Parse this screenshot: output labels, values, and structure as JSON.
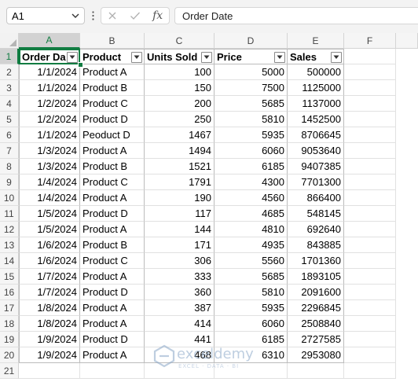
{
  "formula_bar": {
    "name_box": "A1",
    "fx_symbol": "fx",
    "content": "Order Date"
  },
  "columns": [
    "A",
    "B",
    "C",
    "D",
    "E",
    "F"
  ],
  "selected_column": "A",
  "selected_row": "1",
  "table": {
    "headers": [
      "Order Da",
      "Product",
      "Units Sold",
      "Price",
      "Sales"
    ],
    "rows": [
      [
        "1/1/2024",
        "Product A",
        "100",
        "5000",
        "500000"
      ],
      [
        "1/1/2024",
        "Product B",
        "150",
        "7500",
        "1125000"
      ],
      [
        "1/2/2024",
        "Product C",
        "200",
        "5685",
        "1137000"
      ],
      [
        "1/2/2024",
        "Product D",
        "250",
        "5810",
        "1452500"
      ],
      [
        "1/1/2024",
        "Peoduct D",
        "1467",
        "5935",
        "8706645"
      ],
      [
        "1/3/2024",
        "Product A",
        "1494",
        "6060",
        "9053640"
      ],
      [
        "1/3/2024",
        "Product B",
        "1521",
        "6185",
        "9407385"
      ],
      [
        "1/4/2024",
        "Product C",
        "1791",
        "4300",
        "7701300"
      ],
      [
        "1/4/2024",
        "Product A",
        "190",
        "4560",
        "866400"
      ],
      [
        "1/5/2024",
        "Product D",
        "117",
        "4685",
        "548145"
      ],
      [
        "1/5/2024",
        "Product A",
        "144",
        "4810",
        "692640"
      ],
      [
        "1/6/2024",
        "Product B",
        "171",
        "4935",
        "843885"
      ],
      [
        "1/6/2024",
        "Product C",
        "306",
        "5560",
        "1701360"
      ],
      [
        "1/7/2024",
        "Product A",
        "333",
        "5685",
        "1893105"
      ],
      [
        "1/7/2024",
        "Product D",
        "360",
        "5810",
        "2091600"
      ],
      [
        "1/8/2024",
        "Product A",
        "387",
        "5935",
        "2296845"
      ],
      [
        "1/8/2024",
        "Product A",
        "414",
        "6060",
        "2508840"
      ],
      [
        "1/9/2024",
        "Product D",
        "441",
        "6185",
        "2727585"
      ],
      [
        "1/9/2024",
        "Product A",
        "468",
        "6310",
        "2953080"
      ]
    ]
  },
  "watermark": {
    "brand": "exceldemy",
    "tagline": "EXCEL · DATA · BI"
  },
  "colors": {
    "selection": "#107c41",
    "header_bg": "#f5f5f5"
  }
}
